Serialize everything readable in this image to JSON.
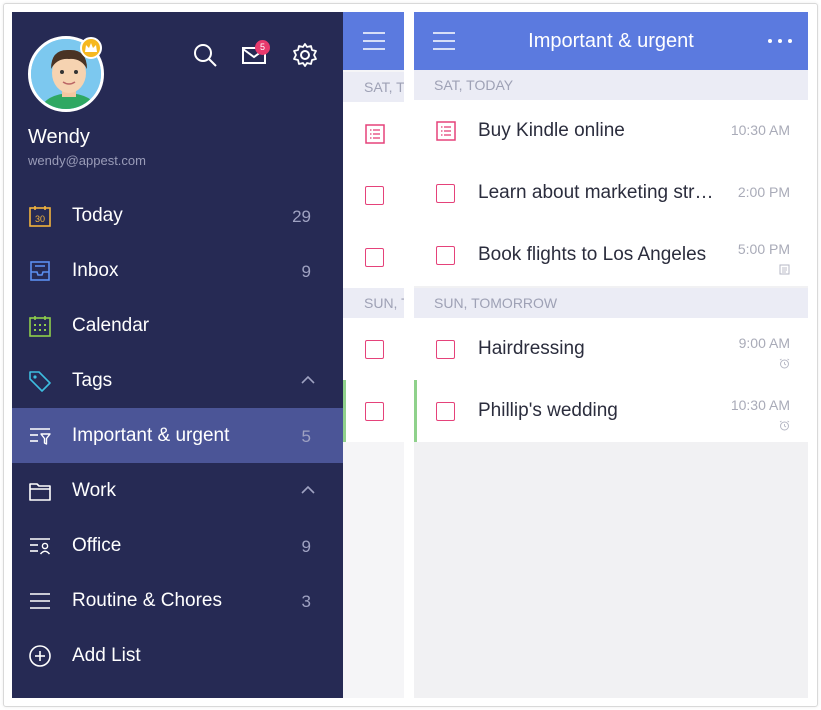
{
  "user": {
    "name": "Wendy",
    "email": "wendy@appest.com",
    "mail_badge": "5"
  },
  "nav": [
    {
      "id": "today",
      "label": "Today",
      "count": "29",
      "icon": "calendar-today-icon",
      "icon_text": "30"
    },
    {
      "id": "inbox",
      "label": "Inbox",
      "count": "9",
      "icon": "inbox-icon"
    },
    {
      "id": "calendar",
      "label": "Calendar",
      "count": "",
      "icon": "calendar-grid-icon"
    },
    {
      "id": "tags",
      "label": "Tags",
      "count": "",
      "icon": "tag-icon",
      "expanded": true
    },
    {
      "id": "important",
      "label": "Important & urgent",
      "count": "5",
      "icon": "filter-list-icon",
      "active": true
    },
    {
      "id": "work",
      "label": "Work",
      "count": "",
      "icon": "folder-icon",
      "expanded": true
    },
    {
      "id": "office",
      "label": "Office",
      "count": "9",
      "icon": "person-list-icon"
    },
    {
      "id": "routine",
      "label": "Routine & Chores",
      "count": "3",
      "icon": "list-icon"
    },
    {
      "id": "add",
      "label": "Add List",
      "count": "",
      "icon": "add-circle-icon"
    }
  ],
  "peek": {
    "date1": "SAT, TODAY",
    "date2": "SUN, TOMORROW"
  },
  "main": {
    "title": "Important & urgent",
    "sections": [
      {
        "date": "SAT, TODAY",
        "tasks": [
          {
            "title": "Buy Kindle online",
            "time": "10:30 AM",
            "type": "note"
          },
          {
            "title": "Learn about marketing strategy",
            "time": "2:00 PM",
            "type": "task"
          },
          {
            "title": "Book flights to Los Angeles",
            "time": "5:00 PM",
            "type": "task",
            "sub": "note-icon"
          }
        ]
      },
      {
        "date": "SUN, TOMORROW",
        "tasks": [
          {
            "title": "Hairdressing",
            "time": "9:00 AM",
            "type": "task",
            "sub": "alarm-icon"
          },
          {
            "title": "Phillip's wedding",
            "time": "10:30 AM",
            "type": "task",
            "sub": "alarm-icon",
            "flag": true
          }
        ]
      }
    ]
  },
  "colors": {
    "sidebar": "#262a54",
    "active": "#4b5597",
    "header": "#5b7adf",
    "checkbox": "#e5427a",
    "flag": "#8fd18b"
  }
}
